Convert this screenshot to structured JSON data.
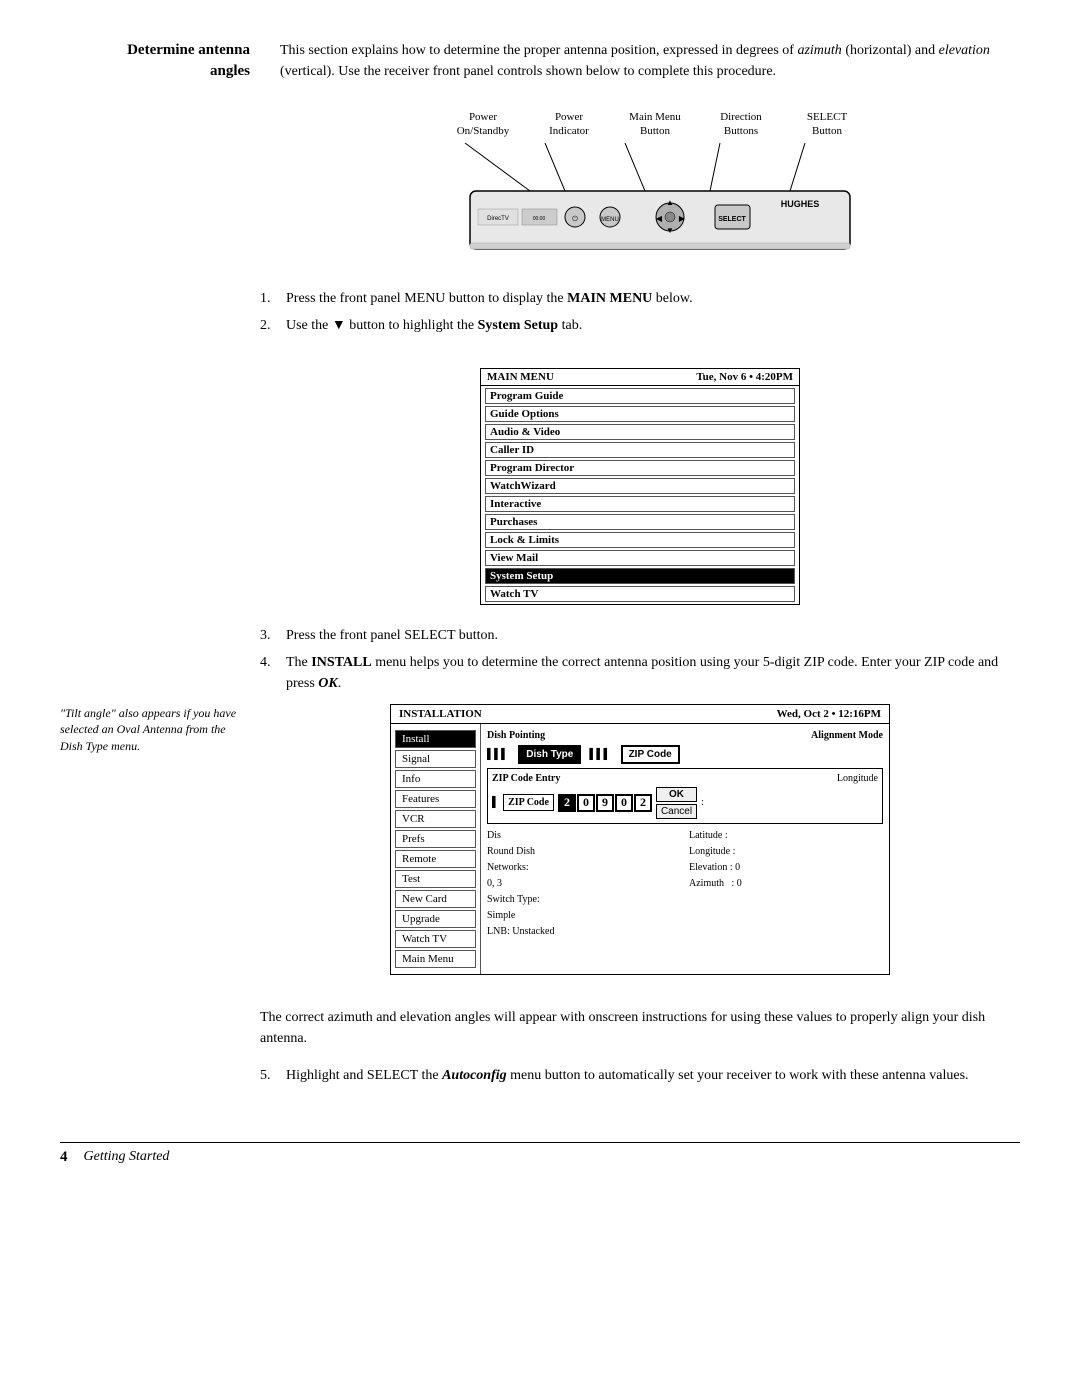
{
  "header": {
    "title_line1": "Determine antenna",
    "title_line2": "angles",
    "description": "This section explains how to determine the proper antenna position, expressed in degrees of azimuth (horizontal) and elevation (vertical). Use the receiver front panel controls shown below to complete this procedure."
  },
  "diagram": {
    "labels": [
      {
        "id": "power-on-standby",
        "text": "Power\nOn/Standby"
      },
      {
        "id": "power-indicator",
        "text": "Power\nIndicator"
      },
      {
        "id": "main-menu-button",
        "text": "Main Menu\nButton"
      },
      {
        "id": "direction-buttons",
        "text": "Direction\nButtons"
      },
      {
        "id": "select-button",
        "text": "SELECT\nButton"
      }
    ]
  },
  "steps": {
    "step1": "Press the front panel MENU button to display the ",
    "step1_bold": "MAIN MENU",
    "step1_end": " below.",
    "step2": "Use the ▼ button to highlight the ",
    "step2_bold": "System Setup",
    "step2_end": " tab."
  },
  "main_menu": {
    "title": "MAIN MENU",
    "timestamp": "Tue, Nov 6  •  4:20PM",
    "items": [
      {
        "label": "Program Guide",
        "highlighted": false
      },
      {
        "label": "Guide Options",
        "highlighted": false
      },
      {
        "label": "Audio & Video",
        "highlighted": false
      },
      {
        "label": "Caller ID",
        "highlighted": false
      },
      {
        "label": "Program Director",
        "highlighted": false
      },
      {
        "label": "WatchWizard",
        "highlighted": false
      },
      {
        "label": "Interactive",
        "highlighted": false
      },
      {
        "label": "Purchases",
        "highlighted": false
      },
      {
        "label": "Lock & Limits",
        "highlighted": false
      },
      {
        "label": "View Mail",
        "highlighted": false
      },
      {
        "label": "System Setup",
        "highlighted": true
      },
      {
        "label": "Watch TV",
        "highlighted": false
      }
    ]
  },
  "sidebar_note": {
    "text": "\"Tilt angle\" also appears if you have selected an Oval Antenna from the Dish Type menu."
  },
  "step3": "Press the front panel SELECT button.",
  "step4_start": "The ",
  "step4_bold": "INSTALL",
  "step4_mid": " menu helps you to determine the correct antenna position using your 5-digit ZIP code. Enter your ZIP code and press ",
  "step4_italic_bold": "OK",
  "step4_end": ".",
  "installation": {
    "title": "INSTALLATION",
    "timestamp": "Wed, Oct 2  •  12:16PM",
    "left_menu": [
      {
        "label": "Install",
        "active": true
      },
      {
        "label": "Signal",
        "active": false
      },
      {
        "label": "Info",
        "active": false
      },
      {
        "label": "Features",
        "active": false
      },
      {
        "label": "VCR",
        "active": false
      },
      {
        "label": "Prefs",
        "active": false
      },
      {
        "label": "Remote",
        "active": false
      },
      {
        "label": "Test",
        "active": false
      },
      {
        "label": "New Card",
        "active": false
      },
      {
        "label": "Upgrade",
        "active": false
      },
      {
        "label": "Watch TV",
        "active": false
      },
      {
        "label": "Main Menu",
        "active": false
      }
    ],
    "dish_pointing": "Dish Pointing",
    "alignment_mode": "Alignment Mode",
    "dish_type_label": "Dish Type",
    "zip_code_label": "ZIP Code",
    "zip_code_entry_header": "ZIP Code Entry",
    "zip_code_inner_label": "ZIP Code",
    "longitude_label": "Longitude",
    "zip_digits": [
      "2",
      "0",
      "9",
      "0",
      "2"
    ],
    "active_digit_index": 0,
    "ok_label": "OK",
    "cancel_label": "Cancel",
    "info_left": {
      "dis_label": "Dis",
      "round_dish_label": "Round Dish",
      "networks_label": "Networks:",
      "networks_value": "0, 3",
      "switch_type_label": "Switch Type:",
      "switch_type_value": "Simple",
      "lnb_label": "LNB: Unstacked"
    },
    "info_right": {
      "latitude_label": "Latitude :",
      "longitude_label": "Longitude :",
      "elevation_label": "Elevation : 0",
      "azimuth_label": "Azimuth   : 0"
    }
  },
  "footer_text": "The correct azimuth and elevation angles will appear with onscreen instructions for using these values to properly align your dish antenna.",
  "step5_start": "Highlight and SELECT the ",
  "step5_italic_bold": "Autoconfig",
  "step5_end": " menu button to automatically set your receiver to work with these antenna values.",
  "page_footer": {
    "number": "4",
    "label": "Getting Started"
  }
}
